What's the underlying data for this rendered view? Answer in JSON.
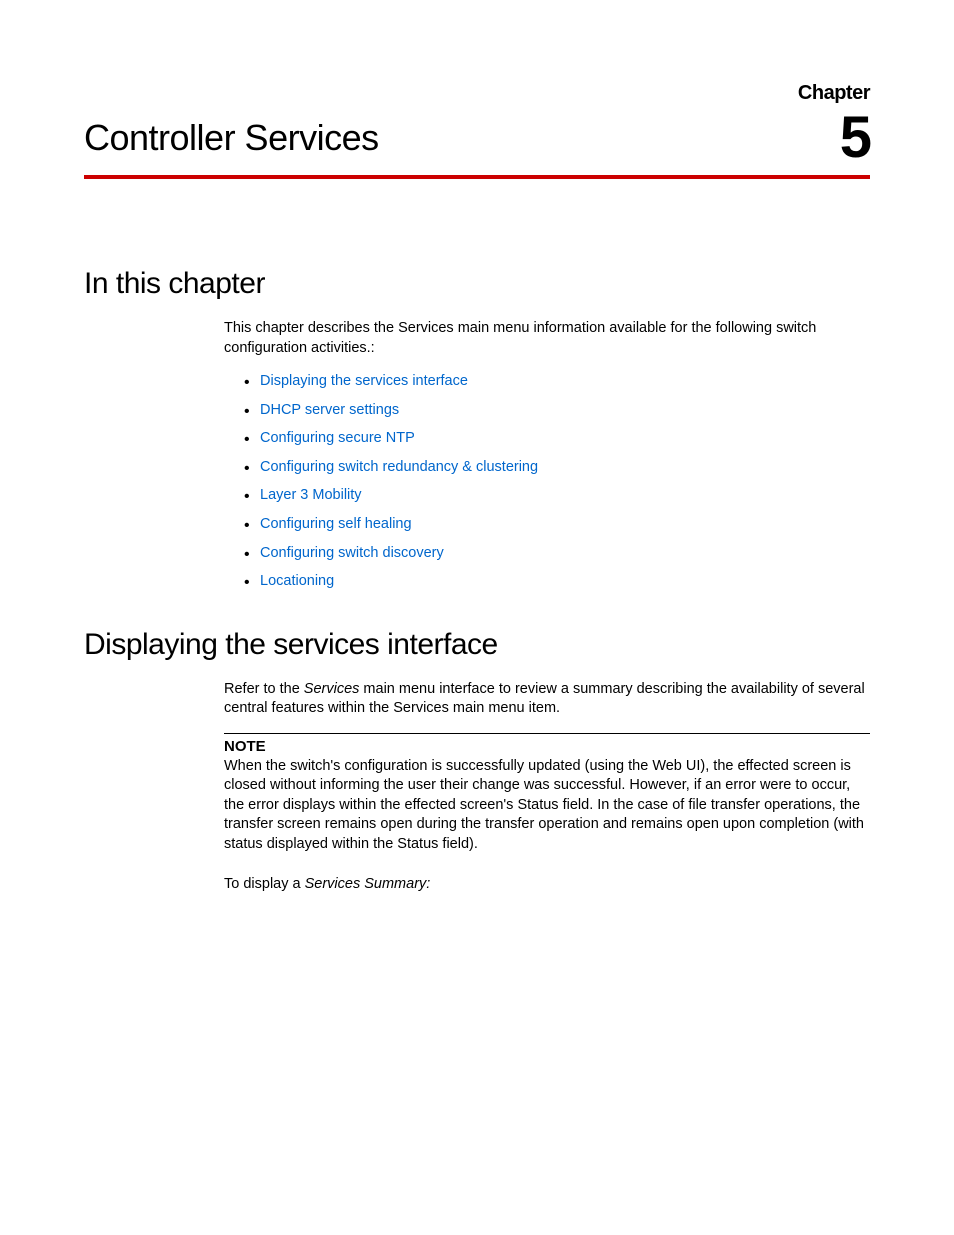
{
  "header": {
    "chapter_label": "Chapter",
    "chapter_number": "5",
    "page_title": "Controller Services"
  },
  "sections": {
    "in_this_chapter": {
      "heading": "In this chapter",
      "intro": "This chapter describes the Services main menu information available for the following switch configuration activities.:",
      "links": [
        "Displaying the services interface",
        "DHCP server settings",
        "Configuring secure NTP",
        "Configuring switch redundancy & clustering",
        "Layer 3 Mobility",
        "Configuring self healing",
        "Configuring switch discovery",
        "Locationing"
      ]
    },
    "displaying": {
      "heading": "Displaying the services interface",
      "para1_pre": "Refer to the ",
      "para1_italic": "Services",
      "para1_post": " main menu interface to review a summary describing the availability of several central features within the Services main menu item.",
      "note_label": "NOTE",
      "note_body": "When the switch's configuration is successfully updated (using the Web UI), the effected screen is closed without informing the user their change was successful. However, if an error were to occur, the error displays within the effected screen's Status field. In the case of file transfer operations, the transfer screen remains open during the transfer operation and remains open upon completion (with status displayed within the Status field).",
      "para2_pre": "To display a ",
      "para2_italic": "Services Summary:"
    }
  }
}
